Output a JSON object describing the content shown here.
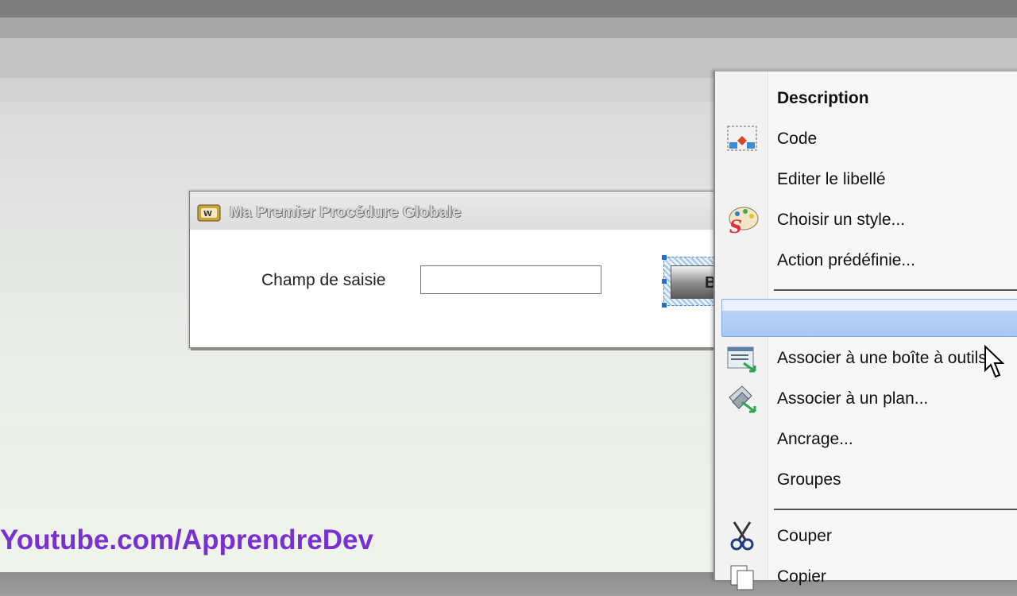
{
  "window": {
    "title": "Ma Premier Procédure Globale",
    "field_label": "Champ de saisie",
    "field_value": "",
    "button_label": "B"
  },
  "context_menu": {
    "items": [
      {
        "label": "Description",
        "icon": "",
        "bold": true
      },
      {
        "label": "Code",
        "icon": "code-window-icon"
      },
      {
        "label": "Editer le libellé",
        "icon": ""
      },
      {
        "label": "Choisir un style...",
        "icon": "style-palette-icon"
      },
      {
        "label": "Action prédéfinie...",
        "icon": ""
      },
      {
        "label": "",
        "icon": "",
        "highlighted": true
      },
      {
        "label": "Associer à une boîte à outils...",
        "icon": "toolbox-associate-icon"
      },
      {
        "label": "Associer à un plan...",
        "icon": "plan-associate-icon"
      },
      {
        "label": "Ancrage...",
        "icon": ""
      },
      {
        "label": "Groupes",
        "icon": ""
      },
      {
        "label": "Couper",
        "icon": "scissors-icon"
      },
      {
        "label": "Copier",
        "icon": "copy-icon"
      }
    ]
  },
  "watermark": "Youtube.com/ApprendreDev",
  "colors": {
    "highlight": "#b9d3f4",
    "watermark": "#7a2fd1",
    "selection": "#1e6fd9"
  }
}
